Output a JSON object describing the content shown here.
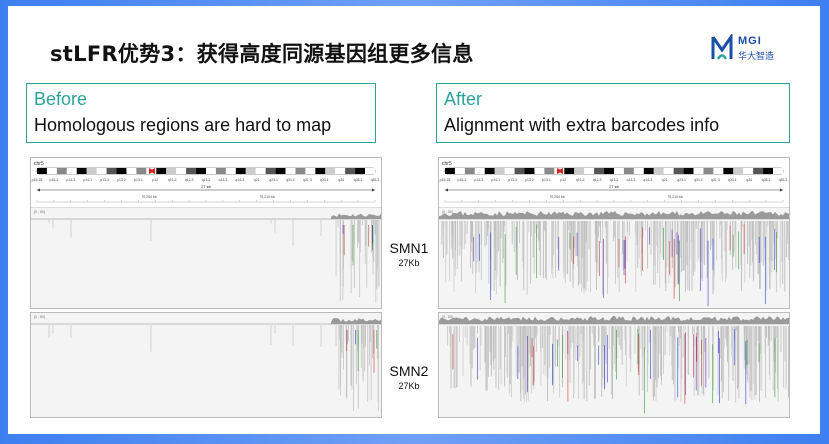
{
  "title": "stLFR优势3：获得高度同源基因组更多信息",
  "logo": {
    "brand": "MGI",
    "cn": "华大智造"
  },
  "before": {
    "heading": "Before",
    "text": "Homologous regions are hard to map"
  },
  "after": {
    "heading": "After",
    "text": "Alignment with extra barcodes info"
  },
  "tracks": [
    {
      "name": "SMN1",
      "size": "27Kb"
    },
    {
      "name": "SMN2",
      "size": "27Kb"
    }
  ],
  "ideogram": {
    "chrom": "chr5",
    "bands": [
      "p15.33",
      "p15.2",
      "p14.3",
      "p14.1",
      "p13.3",
      "p13.2",
      "p13.1",
      "p12",
      "q11.2",
      "q12.3",
      "q13.2",
      "q13.3",
      "q14.3",
      "q21",
      "q23.1",
      "q31.1",
      "q31.3",
      "q33.1",
      "q34",
      "q35.1",
      "q35.3"
    ],
    "span": "27 kb",
    "ticks": [
      "70,200 kb",
      "70,210 kb"
    ]
  },
  "colors": {
    "accent": "#2aa39a",
    "background": "#3d7ff0",
    "logo": "#1a4fa8"
  }
}
